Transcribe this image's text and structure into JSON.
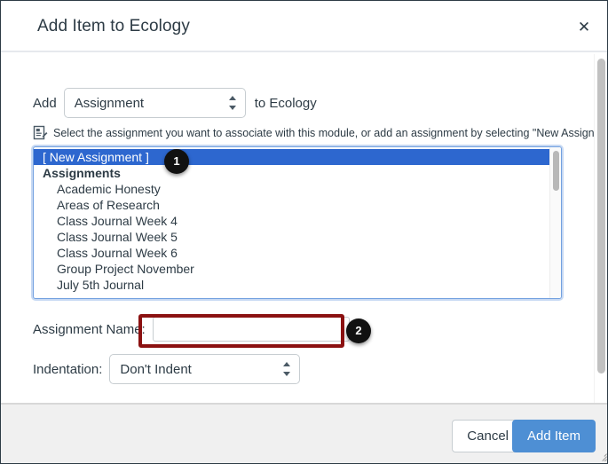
{
  "modal": {
    "title": "Add Item to Ecology",
    "close_icon": "close-icon"
  },
  "form": {
    "add_label": "Add",
    "type_value": "Assignment",
    "to_module_label": "to Ecology",
    "hint_icon": "assignment-document-icon",
    "hint_text": "Select the assignment you want to associate with this module, or add an assignment by selecting \"New Assignment\".",
    "name_label": "Assignment Name:",
    "name_value": "",
    "name_placeholder": "",
    "indent_label": "Indentation:",
    "indent_value": "Don't Indent"
  },
  "assignment_list": {
    "options": [
      {
        "label": "[ New Assignment ]",
        "type": "item",
        "selected": true
      },
      {
        "label": "Assignments",
        "type": "group",
        "selected": false
      },
      {
        "label": "Academic Honesty",
        "type": "child",
        "selected": false
      },
      {
        "label": "Areas of Research",
        "type": "child",
        "selected": false
      },
      {
        "label": "Class Journal Week 4",
        "type": "child",
        "selected": false
      },
      {
        "label": "Class Journal Week 5",
        "type": "child",
        "selected": false
      },
      {
        "label": "Class Journal Week 6",
        "type": "child",
        "selected": false
      },
      {
        "label": "Group Project November",
        "type": "child",
        "selected": false
      },
      {
        "label": "July 5th Journal",
        "type": "child",
        "selected": false
      }
    ]
  },
  "annotations": [
    {
      "number": "1",
      "target": "new-assignment-option"
    },
    {
      "number": "2",
      "target": "assignment-name-field"
    }
  ],
  "footer": {
    "cancel_label": "Cancel",
    "add_item_label": "Add Item"
  },
  "colors": {
    "selection_blue": "#2d67cf",
    "primary_button": "#4e8fd4",
    "annotation_red": "#8b1111",
    "badge_black": "#111111",
    "focus_outline": "#73a1e0"
  }
}
